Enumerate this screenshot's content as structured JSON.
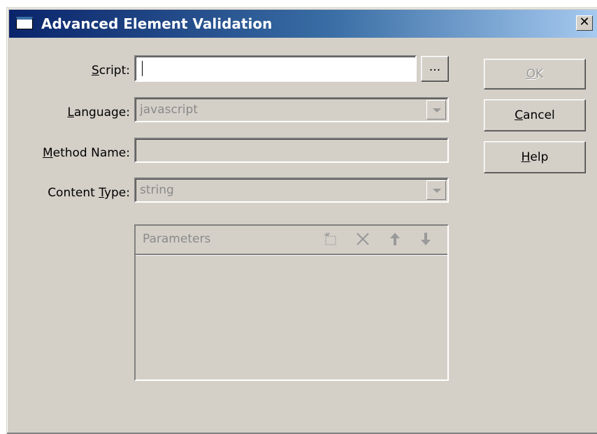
{
  "window": {
    "title": "Advanced Element Validation",
    "close_label": "✕"
  },
  "form": {
    "script": {
      "label": "Script:",
      "value": "",
      "browse_label": "..."
    },
    "language": {
      "label": "Language:",
      "value": "javascript"
    },
    "method_name": {
      "label": "Method Name:",
      "value": ""
    },
    "content_type": {
      "label": "Content Type:",
      "value": "string"
    }
  },
  "parameters": {
    "title": "Parameters",
    "toolbar_icons": [
      "new-icon",
      "delete-icon",
      "move-up-icon",
      "move-down-icon"
    ],
    "rows": []
  },
  "buttons": {
    "ok": "OK",
    "cancel": "Cancel",
    "help": "Help"
  },
  "colors": {
    "dialog_bg": "#d4d0c8",
    "title_start": "#0a246a",
    "title_end": "#a6caf0"
  }
}
